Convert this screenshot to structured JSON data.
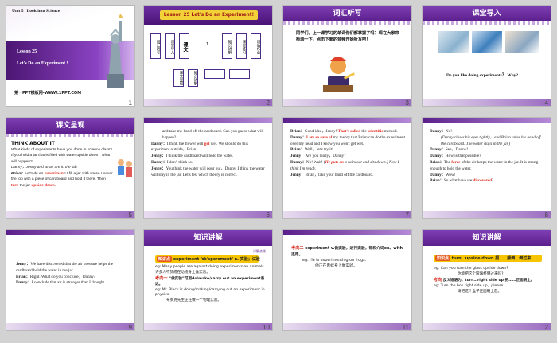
{
  "slides": [
    {
      "num": "1",
      "unit": "Unit 5",
      "unit_title": "Look into Science",
      "lesson": "Lesson 25",
      "title": "Let's Do an Experiment !",
      "footer": "第一PPT模板网-WWW.1PPT.COM"
    },
    {
      "num": "2",
      "header": "Lesson 25 Let's Do an Experiment!",
      "left_boxes": [
        "词汇听写",
        "课堂导入",
        "课文"
      ],
      "right_boxes": [
        "知识讲解",
        "课堂练习",
        "课后作业"
      ],
      "mid": "课文朗读",
      "sub_left": "课文呈现",
      "sub_mid": "知识讲解",
      "dash": "1"
    },
    {
      "num": "3",
      "banner": "词汇听写",
      "text": "同学们，上一课学习的单词你们都掌握了吗？现在大家来检验一下，点击下面的音频开始听写吧！"
    },
    {
      "num": "4",
      "banner": "课堂导入",
      "question": "Do you like doing experiments？ Why?"
    },
    {
      "num": "5",
      "banner": "课文呈现",
      "heading": "THINK ABOUT IT",
      "lines": [
        "What kinds of experiments have you done in science class?",
        "If you hold a jar that is filled with water upside down，what will happen?",
        "Danny，Jenny and Brian are in the lab."
      ],
      "l1a": "Brian：",
      "l1b": "Let's do an ",
      "l1c": "experiment",
      "l1d": "! I fill a jar with water. I cover the top with a piece of cardboard and hold it there. Then I ",
      "l1e": "turn",
      "l1f": " the jar ",
      "l1g": "upside down",
      "l1h": "."
    },
    {
      "num": "6",
      "p1": "and take my hand off the cardboard. Can you guess what will happen?",
      "p2a": "Danny：",
      "p2b": "I think the flower will ",
      "p2c": "get",
      "p2d": " wet. We should do this experiment outside，Brian.",
      "p3a": "Jenny：",
      "p3b": "I think the cardboard will hold the water.",
      "p4a": "Danny：",
      "p4b": "I don't think so.",
      "p5a": "Jenny：",
      "p5b": "You think the water will pour out，Danny. I think the water will stay in the jar. Let's test which theory is correct."
    },
    {
      "num": "7",
      "l1a": "Brian：",
      "l1b": "Good idea，Jenny! ",
      "l1c": "That's called",
      "l1d": " the ",
      "l1e": "scientific",
      "l1f": " method.",
      "l2a": "Danny：",
      "l2b": "I am so sure of",
      "l2c": " my theory that Brian can do the experiment over my head and I know you won't get wet.",
      "l3a": "Brian：",
      "l3b": "Well，let's try it!",
      "l4a": "Jenny：",
      "l4b": "Are you ready，Danny?",
      "l5a": "Danny：",
      "l5b": "No! Wait! (",
      "l5c": "He puts on",
      "l5d": " a raincoat and sits down.) Now I think I'm ready.",
      "l6a": "Jenny：",
      "l6b": "Brian，take your hand off the cardboard."
    },
    {
      "num": "8",
      "l1a": "Danny：",
      "l1b": "No!",
      "l1c": "(Danny closes his eyes tightly，and Brian takes his hand off the cardboard. The water stays in the jar.)",
      "l2a": "Danny：",
      "l2b": "See，Danny!",
      "l3a": "Danny：",
      "l3b": "How is that possible?",
      "l4a": "Brian：",
      "l4b": "The ",
      "l4c": "force",
      "l4d": " of the air keeps the water in the jar. It is strong enough to hold the water.",
      "l5a": "Danny：",
      "l5b": "Wow!",
      "l6a": "Brian：",
      "l6b": "So what have we ",
      "l6c": "discovered",
      "l6d": "?"
    },
    {
      "num": "9",
      "l1a": "Jenny：",
      "l1b": "We have discovered that the air pressure helps the cardboard hold the water in the jar.",
      "l2a": "Brian：",
      "l2b": "Right. What do you conclude，Danny?",
      "l3a": "Danny：",
      "l3b": "I conclude that air is stronger than I thought."
    },
    {
      "num": "10",
      "banner": "知识讲解",
      "tag": "知识点",
      "kp": "experiment /ɪkˈsperɪmənt/ n. 实验；试验",
      "ex1": "Many people are against doing experiments on animals. 许多人不赞成在动物身上做实验。",
      "note": "“做实验”可用do/make/carry out an experiment表达。",
      "ex2": "Mr. Black is doing/making/carrying out an experiment in physics.",
      "ex2zh": "布莱克先生正在做一个物理实验。",
      "eg": "eg:",
      "kd": "考向一",
      "topr": "详解点拨"
    },
    {
      "num": "11",
      "kd": "考向二",
      "kp": "experiment v.做实验，进行实验，常和介词on、with连用。",
      "eg": "eg:",
      "ex": "He is experimenting on frogs.",
      "exzh": "他正在青蛙身上做实验。"
    },
    {
      "num": "12",
      "banner": "知识讲解",
      "tag": "知识点",
      "kp": "turn…upside down 把……颠倒；倒过来",
      "eg1": "Can you turn the glass upside down?",
      "eg1zh": "你能把这个玻璃杯倒过来吗?",
      "note": "反义短语为：turn…right side up 把……正面朝上。",
      "eg2": "Turn the box right side up，please.",
      "eg2zh": "请把这个盒子正面朝上放。",
      "eg": "eg:",
      "kd": "考向"
    }
  ]
}
